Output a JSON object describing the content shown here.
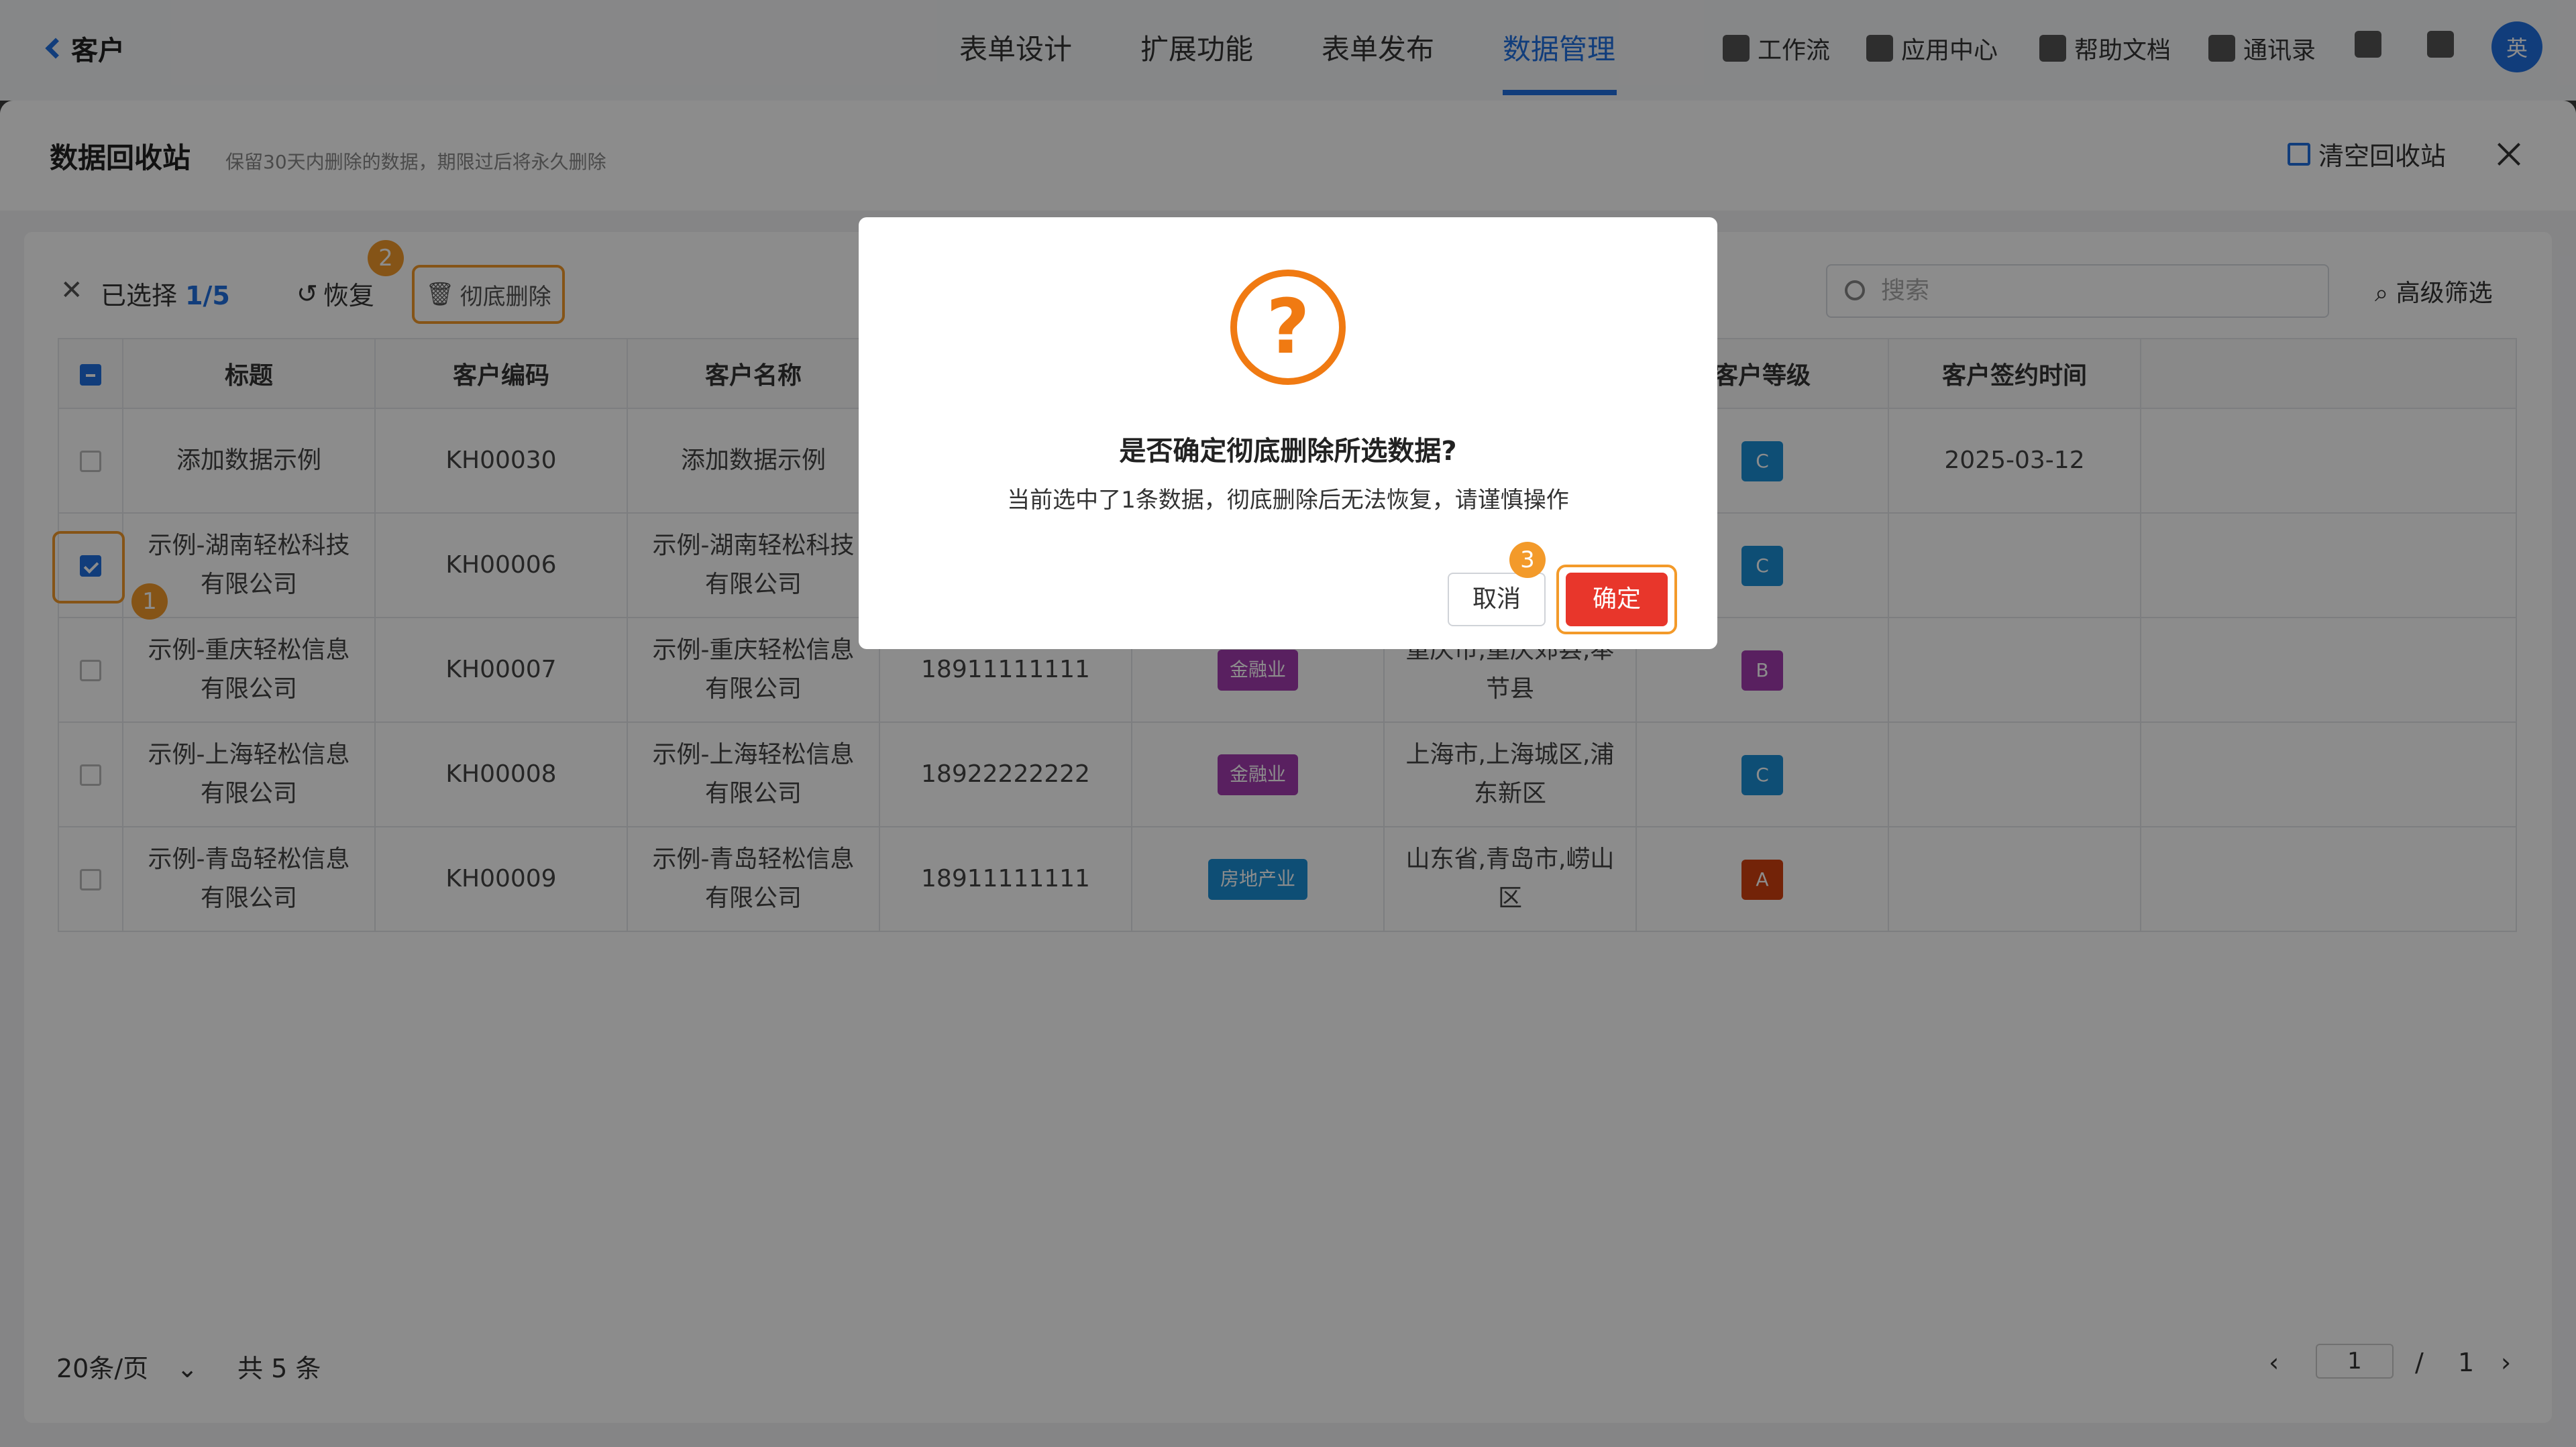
{
  "header": {
    "back_label": "客户",
    "tabs": [
      "表单设计",
      "扩展功能",
      "表单发布",
      "数据管理"
    ],
    "tools": [
      "工作流",
      "应用中心",
      "帮助文档",
      "通讯录"
    ],
    "avatar": "英"
  },
  "drawer": {
    "title": "数据回收站",
    "subtitle": "保留30天内删除的数据，期限过后将永久删除",
    "clear_label": "清空回收站"
  },
  "toolbar": {
    "selected_prefix": "已选择",
    "selected_count": "1/5",
    "restore": "恢复",
    "delete_forever": "彻底删除",
    "search_placeholder": "搜索",
    "advanced_filter": "高级筛选"
  },
  "table": {
    "columns": [
      "标题",
      "客户编码",
      "客户名称",
      "",
      "",
      "",
      "客户等级",
      "客户签约时间"
    ],
    "rows": [
      {
        "title": "添加数据示例",
        "code": "KH00030",
        "name": "添加数据示例",
        "phone": "",
        "industry": "",
        "industry_color": "",
        "region": "",
        "level": "C",
        "level_color": "#1a8fd6",
        "date": "2025-03-12",
        "checked": false
      },
      {
        "title": "示例-湖南轻松科技有限公司",
        "code": "KH00006",
        "name": "示例-湖南轻松科技有限公司",
        "phone": "",
        "industry": "",
        "industry_color": "",
        "region": "",
        "level": "C",
        "level_color": "#1a8fd6",
        "date": "",
        "checked": true
      },
      {
        "title": "示例-重庆轻松信息有限公司",
        "code": "KH00007",
        "name": "示例-重庆轻松信息有限公司",
        "phone": "18911111111",
        "industry": "金融业",
        "industry_color": "#a23bb0",
        "region": "重庆市,重庆郊县,奉节县",
        "level": "B",
        "level_color": "#a23bb0",
        "date": "",
        "checked": false
      },
      {
        "title": "示例-上海轻松信息有限公司",
        "code": "KH00008",
        "name": "示例-上海轻松信息有限公司",
        "phone": "18922222222",
        "industry": "金融业",
        "industry_color": "#a23bb0",
        "region": "上海市,上海城区,浦东新区",
        "level": "C",
        "level_color": "#1a8fd6",
        "date": "",
        "checked": false
      },
      {
        "title": "示例-青岛轻松信息有限公司",
        "code": "KH00009",
        "name": "示例-青岛轻松信息有限公司",
        "phone": "18911111111",
        "industry": "房地产业",
        "industry_color": "#1a8fd6",
        "region": "山东省,青岛市,崂山区",
        "level": "A",
        "level_color": "#d2400f",
        "date": "",
        "checked": false
      }
    ]
  },
  "footer": {
    "page_size": "20条/页",
    "total": "共 5 条",
    "current_page": "1",
    "separator": "/",
    "total_pages": "1"
  },
  "dialog": {
    "title": "是否确定彻底删除所选数据?",
    "message": "当前选中了1条数据，彻底删除后无法恢复，请谨慎操作",
    "cancel": "取消",
    "confirm": "确定"
  },
  "step_badges": [
    "1",
    "2",
    "3"
  ]
}
